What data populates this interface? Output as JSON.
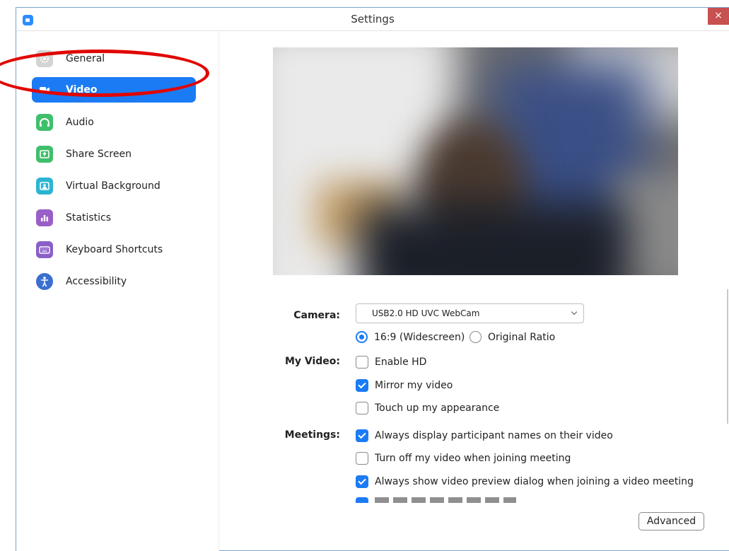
{
  "window": {
    "title": "Settings",
    "close_glyph": "×"
  },
  "sidebar": {
    "items": [
      {
        "label": "General",
        "icon": "gear-icon",
        "color": "#d4d4d4",
        "active": false
      },
      {
        "label": "Video",
        "icon": "video-camera-icon",
        "color": "#1b7bf5",
        "active": true
      },
      {
        "label": "Audio",
        "icon": "headphones-icon",
        "color": "#3fbf6b",
        "active": false
      },
      {
        "label": "Share Screen",
        "icon": "share-screen-icon",
        "color": "#3fbf6b",
        "active": false
      },
      {
        "label": "Virtual Background",
        "icon": "virtual-background-icon",
        "color": "#2bb5d3",
        "active": false
      },
      {
        "label": "Statistics",
        "icon": "statistics-icon",
        "color": "#9a5fc7",
        "active": false
      },
      {
        "label": "Keyboard Shortcuts",
        "icon": "keyboard-icon",
        "color": "#8a5fc7",
        "active": false
      },
      {
        "label": "Accessibility",
        "icon": "accessibility-icon",
        "color": "#3a6fd0",
        "active": false
      }
    ]
  },
  "video": {
    "camera_label": "Camera:",
    "camera_value": "USB2.0 HD UVC WebCam",
    "ratio_options": [
      {
        "label": "16:9 (Widescreen)",
        "selected": true
      },
      {
        "label": "Original Ratio",
        "selected": false
      }
    ],
    "my_video_label": "My Video:",
    "my_video_options": [
      {
        "label": "Enable HD",
        "checked": false
      },
      {
        "label": "Mirror my video",
        "checked": true
      },
      {
        "label": "Touch up my appearance",
        "checked": false
      }
    ],
    "meetings_label": "Meetings:",
    "meetings_options": [
      {
        "label": "Always display participant names on their video",
        "checked": true
      },
      {
        "label": "Turn off my video when joining meeting",
        "checked": false
      },
      {
        "label": "Always show video preview dialog when joining a video meeting",
        "checked": true
      }
    ],
    "advanced_label": "Advanced"
  },
  "colors": {
    "accent": "#1b7bf5",
    "highlight_ring": "#e10600",
    "close": "#c75050"
  }
}
